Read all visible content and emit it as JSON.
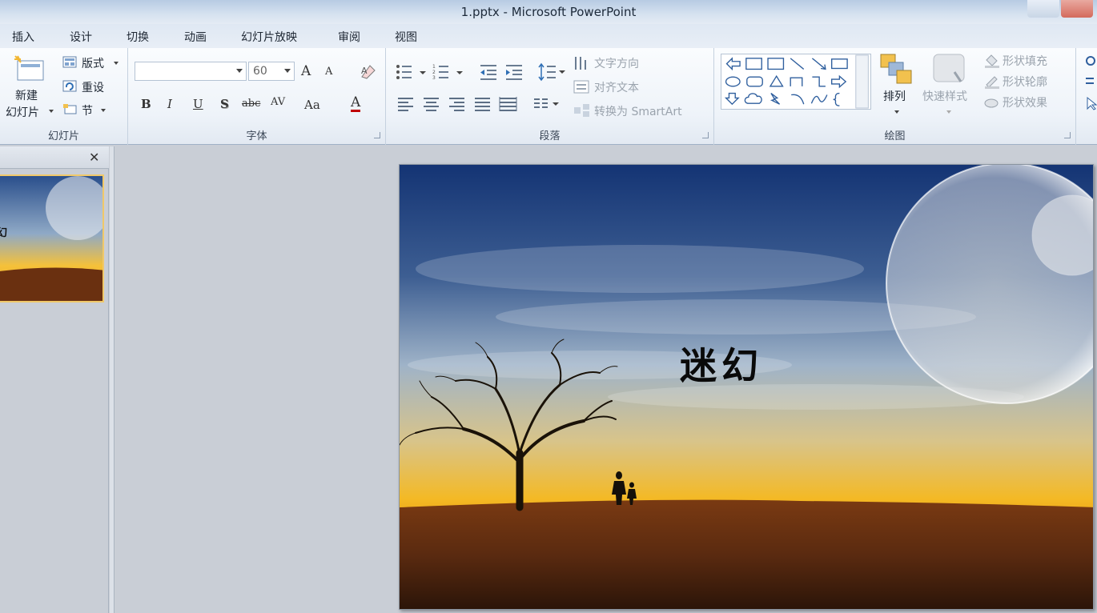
{
  "window": {
    "title": "1.pptx  -  Microsoft PowerPoint"
  },
  "tabs": [
    "插入",
    "设计",
    "切换",
    "动画",
    "幻灯片放映",
    "审阅",
    "视图"
  ],
  "ribbon": {
    "slides_group": {
      "label": "幻灯片",
      "new_slide_line1": "新建",
      "new_slide_line2": "幻灯片",
      "layout": "版式",
      "reset": "重设",
      "section": "节"
    },
    "font_group": {
      "label": "字体",
      "font_name": "",
      "font_size": "60",
      "bold": "B",
      "italic": "I",
      "underline": "U",
      "shadow": "S",
      "strike": "abc",
      "spacing": "AV",
      "case": "Aa",
      "grow": "A",
      "shrink": "A",
      "color": "A"
    },
    "paragraph_group": {
      "label": "段落",
      "text_direction": "文字方向",
      "align_text": "对齐文本",
      "convert_smartart": "转换为 SmartArt"
    },
    "drawing_group": {
      "label": "绘图",
      "arrange": "排列",
      "quick_styles": "快速样式",
      "shape_fill": "形状填充",
      "shape_outline": "形状轮廓",
      "shape_effects": "形状效果"
    }
  },
  "left_pane": {
    "close": "✕",
    "thumb_text": "幻"
  },
  "slide": {
    "title": "迷幻"
  },
  "colors": {
    "accent": "#f0c869",
    "ribbon_border": "#9fb0c6"
  }
}
